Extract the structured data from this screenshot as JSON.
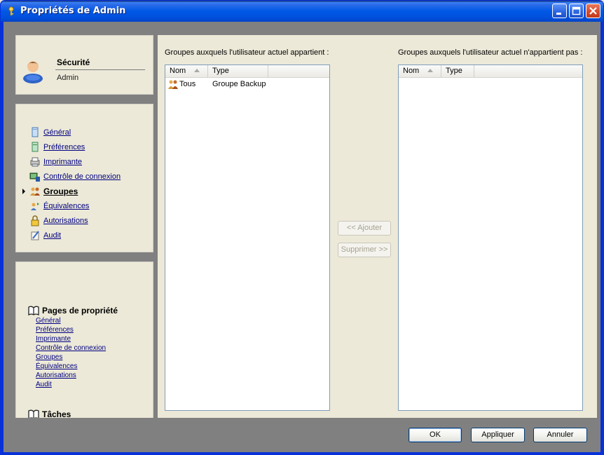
{
  "window": {
    "title": "Propriétés de Admin"
  },
  "titlebar": {
    "buttons": [
      "minimize-icon",
      "maximize-icon",
      "close-icon"
    ]
  },
  "header_panel": {
    "title": "Sécurité",
    "subtitle": "Admin"
  },
  "nav": {
    "items": [
      {
        "label": "Général",
        "icon": "general-page-icon"
      },
      {
        "label": "Préférences",
        "icon": "preferences-page-icon"
      },
      {
        "label": "Imprimante",
        "icon": "printer-icon"
      },
      {
        "label": "Contrôle de connexion",
        "icon": "connection-control-icon"
      },
      {
        "label": "Groupes",
        "icon": "groups-icon",
        "active": true
      },
      {
        "label": "Équivalences",
        "icon": "equivalences-icon"
      },
      {
        "label": "Autorisations",
        "icon": "authorizations-icon"
      },
      {
        "label": "Audit",
        "icon": "audit-icon"
      }
    ]
  },
  "property_pages": {
    "heading": "Pages de propriété",
    "links": [
      "Général",
      "Préférences",
      "Imprimante",
      "Contrôle de connexion",
      "Groupes",
      "Équivalences",
      "Autorisations",
      "Audit"
    ],
    "tasks_heading": "Tâches"
  },
  "left_list": {
    "label": "Groupes auxquels l'utilisateur actuel appartient :",
    "columns": [
      "Nom",
      "Type"
    ],
    "rows": [
      {
        "name": "Tous",
        "type": "Groupe Backup",
        "icon": "group-icon"
      }
    ]
  },
  "right_list": {
    "label": "Groupes auxquels l'utilisateur actuel n'appartient pas :",
    "columns": [
      "Nom",
      "Type"
    ],
    "rows": []
  },
  "actions": {
    "add": "<< Ajouter",
    "remove": "Supprimer >>"
  },
  "footer": {
    "ok": "OK",
    "apply": "Appliquer",
    "cancel": "Annuler"
  },
  "colors": {
    "titlebar": "#0058e6",
    "panel": "#ece9d8",
    "backdrop": "#808080",
    "link": "#000080"
  }
}
